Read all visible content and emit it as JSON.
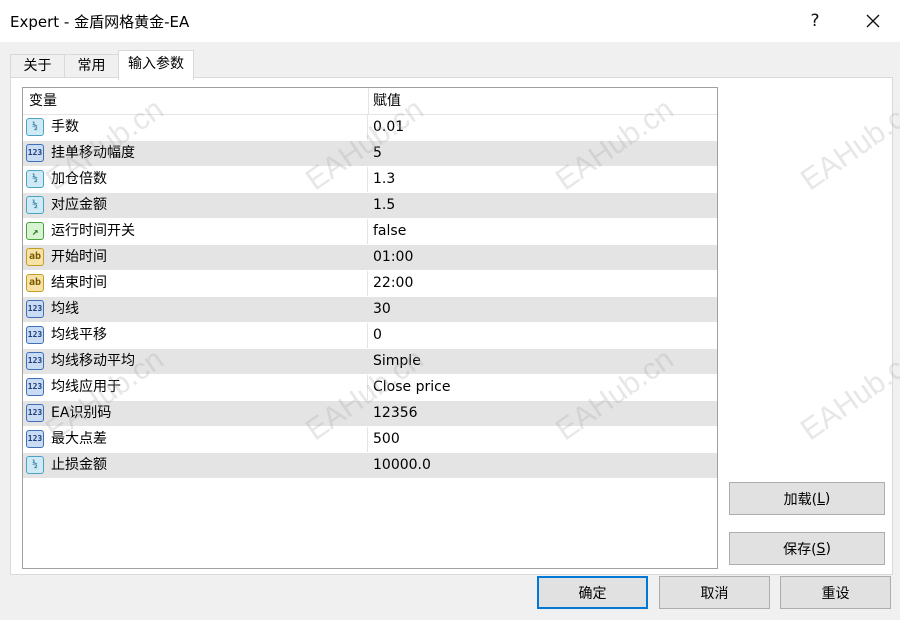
{
  "window": {
    "title": "Expert - 金盾网格黄金-EA",
    "help_label": "?",
    "close_label": "✕"
  },
  "tabs": [
    {
      "label": "关于"
    },
    {
      "label": "常用"
    },
    {
      "label": "输入参数"
    }
  ],
  "active_tab": "输入参数",
  "table": {
    "headers": {
      "name": "变量",
      "value": "赋值"
    },
    "rows": [
      {
        "icon": "float-type-icon",
        "badge": "½",
        "name": "手数",
        "value": "0.01"
      },
      {
        "icon": "int-type-icon",
        "badge": "123",
        "name": "挂单移动幅度",
        "value": "5"
      },
      {
        "icon": "float-type-icon",
        "badge": "½",
        "name": "加仓倍数",
        "value": "1.3"
      },
      {
        "icon": "float-type-icon",
        "badge": "½",
        "name": "对应金额",
        "value": "1.5"
      },
      {
        "icon": "bool-type-icon",
        "badge": "↗",
        "name": "运行时间开关",
        "value": "false"
      },
      {
        "icon": "string-type-icon",
        "badge": "ab",
        "name": "开始时间",
        "value": "01:00"
      },
      {
        "icon": "string-type-icon",
        "badge": "ab",
        "name": "结束时间",
        "value": "22:00"
      },
      {
        "icon": "int-type-icon",
        "badge": "123",
        "name": "均线",
        "value": "30"
      },
      {
        "icon": "int-type-icon",
        "badge": "123",
        "name": "均线平移",
        "value": "0"
      },
      {
        "icon": "int-type-icon",
        "badge": "123",
        "name": "均线移动平均",
        "value": "Simple"
      },
      {
        "icon": "int-type-icon",
        "badge": "123",
        "name": "均线应用于",
        "value": "Close price"
      },
      {
        "icon": "int-type-icon",
        "badge": "123",
        "name": "EA识别码",
        "value": "12356"
      },
      {
        "icon": "int-type-icon",
        "badge": "123",
        "name": "最大点差",
        "value": "500"
      },
      {
        "icon": "float-type-icon",
        "badge": "½",
        "name": "止损金额",
        "value": "10000.0"
      }
    ]
  },
  "side_buttons": {
    "load": {
      "label": "加载(",
      "hotkey": "L",
      "suffix": ")"
    },
    "save": {
      "label": "保存(",
      "hotkey": "S",
      "suffix": ")"
    }
  },
  "footer_buttons": {
    "ok": "确定",
    "cancel": "取消",
    "reset": "重设"
  },
  "watermark": "EAHub.cn"
}
